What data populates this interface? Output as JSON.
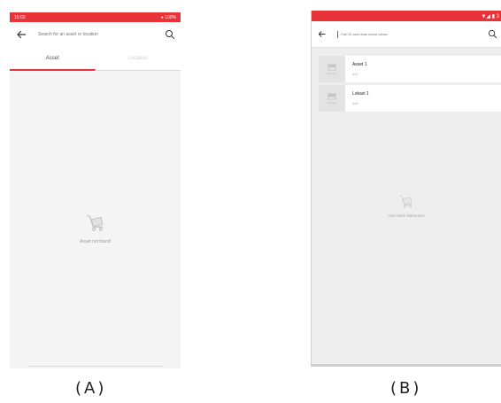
{
  "screen_a": {
    "status_time": "15:03",
    "status_right": "● 100%",
    "search_placeholder": "Search for an asset or location",
    "tabs": [
      {
        "label": "Asset",
        "active": true
      },
      {
        "label": "Location",
        "active": false
      }
    ],
    "empty_message": "Asset not found",
    "caption": "(A)"
  },
  "screen_b": {
    "status_right": "▼◢ ▮ 3",
    "search_placeholder": "Cari ID aset atau nama lokasi",
    "results": [
      {
        "title": "Asset 1",
        "code": "001",
        "thumb_label": "No Image"
      },
      {
        "title": "Lokasi 1",
        "code": "456",
        "thumb_label": "No Image"
      }
    ],
    "empty_message": "Aset tidak ditemukan",
    "caption": "(B)"
  },
  "colors": {
    "accent": "#e8333b",
    "background": "#f4f4f4"
  },
  "icons": [
    "back-arrow-icon",
    "search-icon",
    "image-placeholder-icon",
    "empty-cart-icon"
  ]
}
